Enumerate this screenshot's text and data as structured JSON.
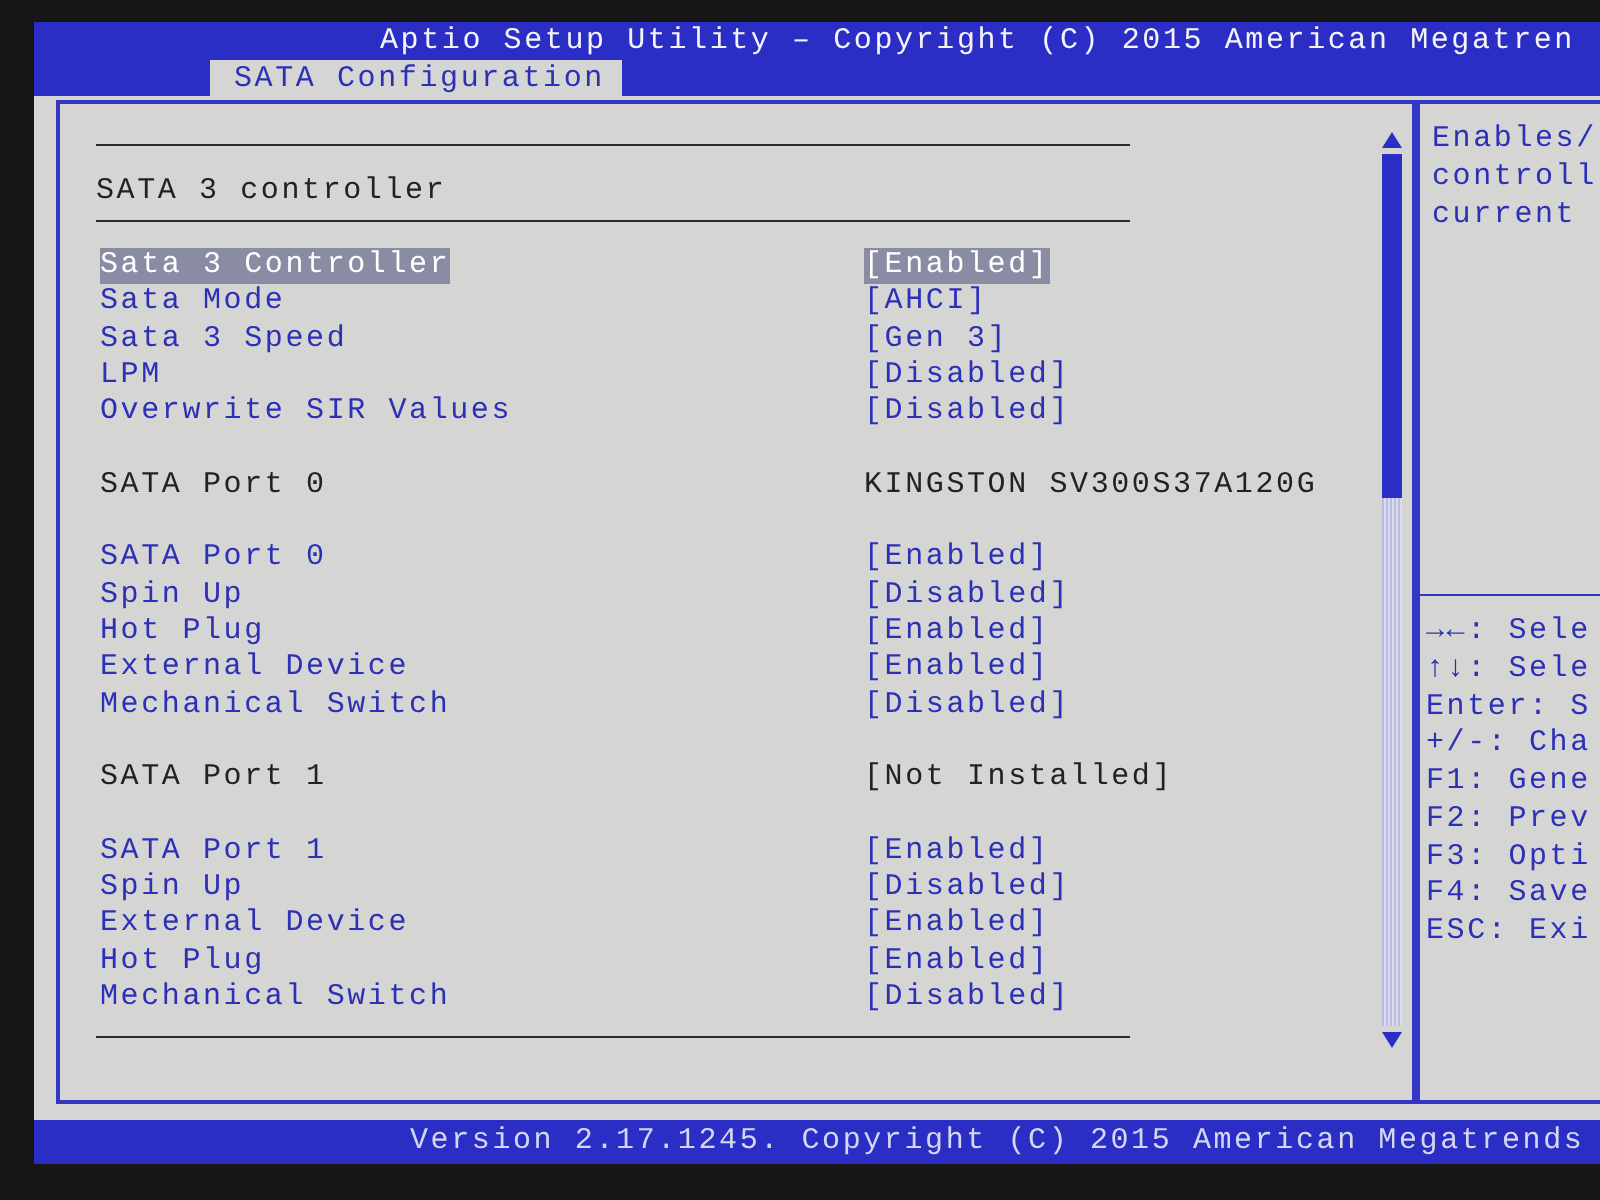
{
  "title_bar": {
    "title": "Aptio Setup Utility – Copyright (C) 2015 American Megatren"
  },
  "tabs": [
    {
      "label": "SATA Configuration",
      "selected": true
    }
  ],
  "section": {
    "title": "SATA 3 controller"
  },
  "rows": [
    {
      "kind": "option",
      "label": "Sata 3 Controller",
      "value": "[Enabled]",
      "selected": true
    },
    {
      "kind": "option",
      "label": "Sata Mode",
      "value": "[AHCI]",
      "selected": false
    },
    {
      "kind": "option",
      "label": "Sata 3 Speed",
      "value": "[Gen 3]",
      "selected": false
    },
    {
      "kind": "option",
      "label": "LPM",
      "value": "[Disabled]",
      "selected": false
    },
    {
      "kind": "option",
      "label": "Overwrite SIR Values",
      "value": "[Disabled]",
      "selected": false
    },
    {
      "kind": "info",
      "label": "SATA Port 0",
      "value": "KINGSTON SV300S37A120G"
    },
    {
      "kind": "option",
      "label": "SATA Port 0",
      "value": "[Enabled]",
      "selected": false
    },
    {
      "kind": "option",
      "label": "Spin Up",
      "value": "[Disabled]",
      "selected": false
    },
    {
      "kind": "option",
      "label": "Hot Plug",
      "value": "[Enabled]",
      "selected": false
    },
    {
      "kind": "option",
      "label": "External Device",
      "value": "[Enabled]",
      "selected": false
    },
    {
      "kind": "option",
      "label": "Mechanical Switch",
      "value": "[Disabled]",
      "selected": false
    },
    {
      "kind": "info",
      "label": "SATA Port 1",
      "value": "[Not Installed]"
    },
    {
      "kind": "option",
      "label": "SATA Port 1",
      "value": "[Enabled]",
      "selected": false
    },
    {
      "kind": "option",
      "label": "Spin Up",
      "value": "[Disabled]",
      "selected": false
    },
    {
      "kind": "option",
      "label": "External Device",
      "value": "[Enabled]",
      "selected": false
    },
    {
      "kind": "option",
      "label": "Hot Plug",
      "value": "[Enabled]",
      "selected": false
    },
    {
      "kind": "option",
      "label": "Mechanical Switch",
      "value": "[Disabled]",
      "selected": false
    }
  ],
  "help": {
    "lines": [
      "Enables/",
      "controll",
      "current"
    ]
  },
  "key_help": [
    "→←: Sele",
    "↑↓: Sele",
    "Enter: S",
    "+/-: Cha",
    "F1: Gene",
    "F2: Prev",
    "F3: Opti",
    "F4: Save",
    "ESC: Exi"
  ],
  "footer": {
    "text": "Version 2.17.1245. Copyright (C) 2015 American Megatrends"
  }
}
